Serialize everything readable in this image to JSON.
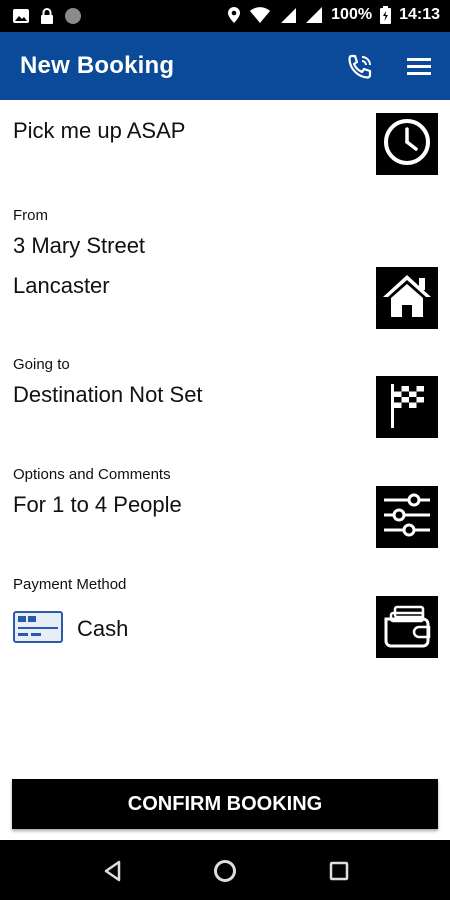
{
  "status_bar": {
    "battery_percent": "100%",
    "time": "14:13",
    "icons": [
      "image-icon",
      "lock-icon",
      "circle-icon",
      "location-icon",
      "wifi-icon",
      "signal-icon",
      "signal-icon",
      "battery-icon"
    ]
  },
  "header": {
    "title": "New Booking",
    "icons": [
      "phone-icon",
      "menu-icon"
    ],
    "colors": {
      "background": "#0b4a98",
      "text": "#ffffff"
    }
  },
  "pickup_time": {
    "value": "Pick me up ASAP",
    "icon": "clock-icon"
  },
  "from": {
    "label": "From",
    "line1": "3 Mary Street",
    "line2": "Lancaster",
    "icon": "home-icon"
  },
  "destination": {
    "label": "Going to",
    "value": "Destination Not Set",
    "icon": "checkered-flag-icon"
  },
  "options": {
    "label": "Options and Comments",
    "value": "For 1 to 4 People",
    "icon": "sliders-icon"
  },
  "payment": {
    "label": "Payment Method",
    "value": "Cash",
    "card_icon": "credit-card-icon",
    "icon": "wallet-icon"
  },
  "confirm": {
    "label": "CONFIRM BOOKING"
  },
  "nav_bar": {
    "icons": [
      "back-icon",
      "home-circle-icon",
      "recents-icon"
    ]
  }
}
